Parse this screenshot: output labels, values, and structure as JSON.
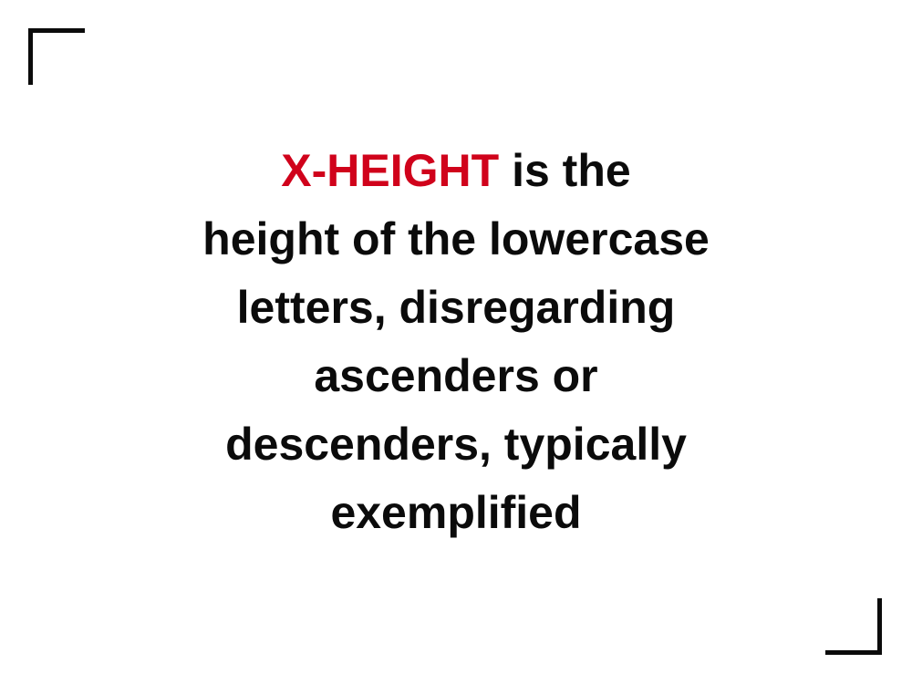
{
  "definition": {
    "term": "X-HEIGHT",
    "term_color": "#d0021b",
    "text_color": "#0b0b0b",
    "line1_rest": " is the",
    "lines": [
      "height of the lowercase",
      "letters, disregarding",
      "ascenders or",
      "descenders, typically",
      "exemplified"
    ]
  }
}
